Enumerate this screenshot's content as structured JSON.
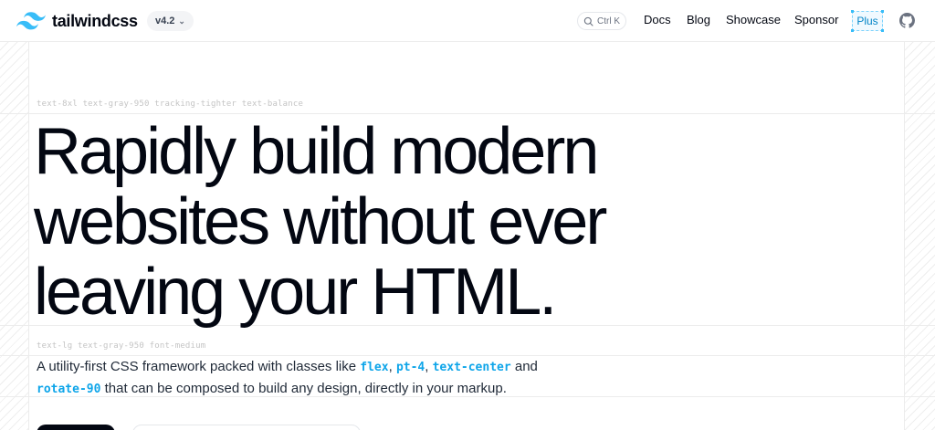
{
  "header": {
    "brand": "tailwindcss",
    "version": "v4.2",
    "search_shortcut": "Ctrl K",
    "nav": {
      "docs": "Docs",
      "blog": "Blog",
      "showcase": "Showcase",
      "sponsor": "Sponsor",
      "plus": "Plus"
    }
  },
  "hero": {
    "title_classes": "text-8xl text-gray-950 tracking-tighter text-balance",
    "title_lines": [
      "Rapidly build modern",
      "websites without ever",
      "leaving your HTML."
    ],
    "subtitle_classes": "text-lg text-gray-950 font-medium",
    "subtitle": {
      "part1": "A utility-first CSS framework packed with classes like ",
      "code1": "flex",
      "sep1": ", ",
      "code2": "pt-4",
      "sep2": ", ",
      "code3": "text-center",
      "part2": " and ",
      "code4": "rotate-90",
      "part3": " that can be composed to build any design, directly in your markup."
    }
  },
  "icons": {
    "logo": "tailwind-logo-icon",
    "chevron": "chevron-down-icon",
    "search": "search-icon",
    "github": "github-icon"
  },
  "colors": {
    "accent": "#0ea5e9",
    "text": "#030712"
  }
}
